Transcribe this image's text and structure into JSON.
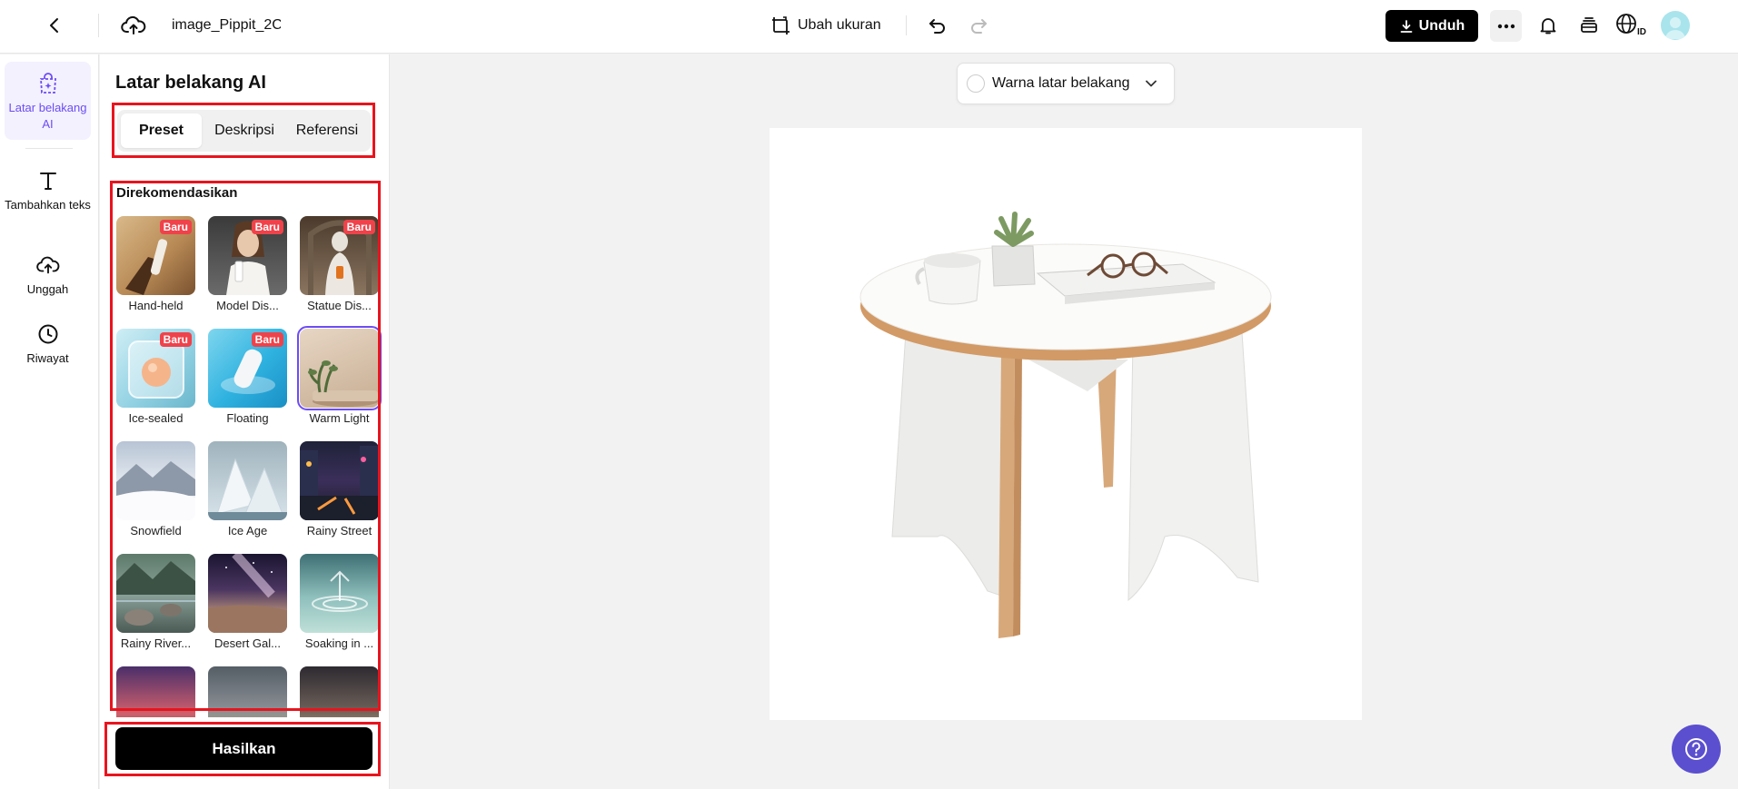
{
  "topbar": {
    "filename": "image_Pippit_2C",
    "resize_label": "Ubah ukuran",
    "download_label": "Unduh",
    "lang_code": "ID"
  },
  "rail": {
    "items": [
      {
        "label": "Latar belakang AI",
        "icon": "ai-background-icon",
        "active": true
      },
      {
        "label": "Tambahkan teks",
        "icon": "text-icon"
      },
      {
        "label": "Unggah",
        "icon": "cloud-upload-icon"
      },
      {
        "label": "Riwayat",
        "icon": "history-clock-icon"
      }
    ]
  },
  "panel": {
    "title": "Latar belakang AI",
    "tabs": [
      "Preset",
      "Deskripsi",
      "Referensi"
    ],
    "active_tab": "Preset",
    "section_title": "Direkomendasikan",
    "badge_label": "Baru",
    "presets": [
      {
        "label": "Hand-held",
        "badge": true
      },
      {
        "label": "Model Dis...",
        "badge": true
      },
      {
        "label": "Statue Dis...",
        "badge": true
      },
      {
        "label": "Ice-sealed",
        "badge": true
      },
      {
        "label": "Floating",
        "badge": true
      },
      {
        "label": "Warm Light",
        "selected": true
      },
      {
        "label": "Snowfield"
      },
      {
        "label": "Ice Age"
      },
      {
        "label": "Rainy Street"
      },
      {
        "label": "Rainy River..."
      },
      {
        "label": "Desert Gal..."
      },
      {
        "label": "Soaking in ..."
      }
    ],
    "generate_label": "Hasilkan"
  },
  "canvas": {
    "bg_color_label": "Warna latar belakang"
  },
  "colors": {
    "accent": "#6c4cf5",
    "highlight": "#e8141e",
    "badge": "#f0424a",
    "help": "#5b4fcf"
  }
}
